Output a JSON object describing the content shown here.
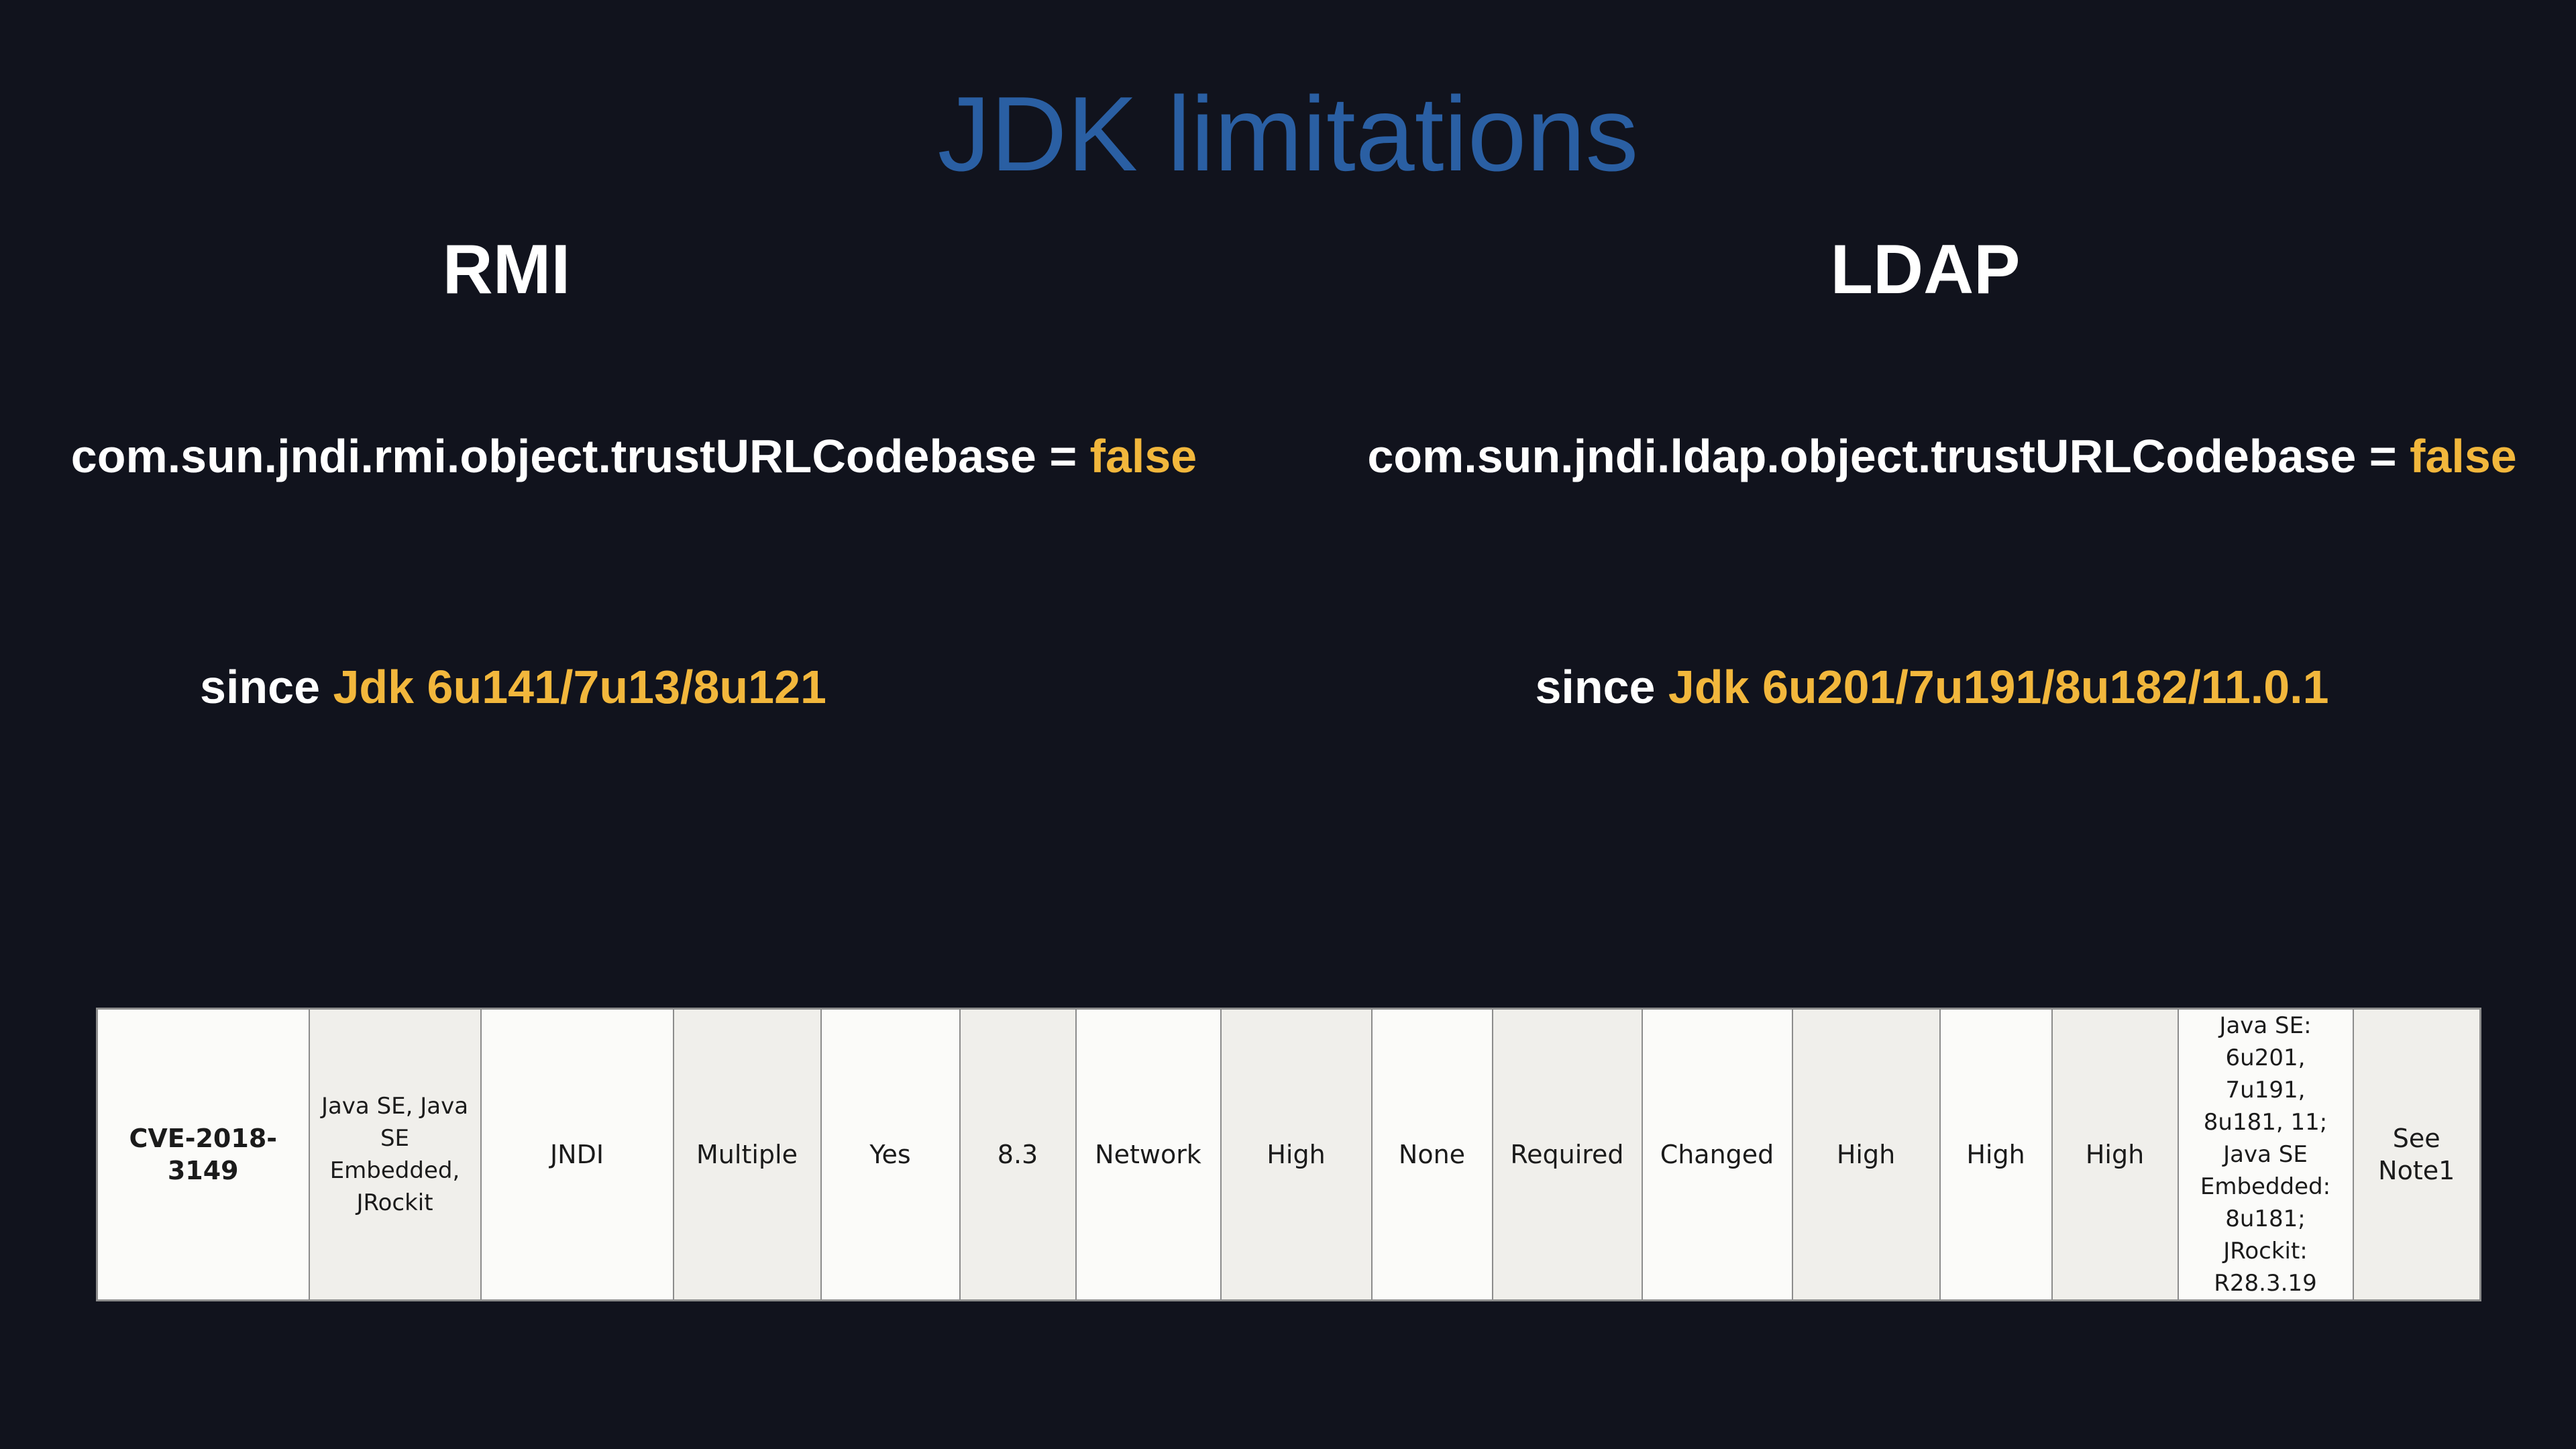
{
  "slide": {
    "title": "JDK limitations",
    "rmi": {
      "heading": "RMI",
      "property_prefix": "com.sun.jndi.rmi.object.trustURLCodebase = ",
      "property_value": "false",
      "since_prefix": "since ",
      "since_versions": "Jdk 6u141/7u13/8u121"
    },
    "ldap": {
      "heading": "LDAP",
      "property_prefix": "com.sun.jndi.ldap.object.trustURLCodebase = ",
      "property_value": "false",
      "since_prefix": "since ",
      "since_versions": "Jdk 6u201/7u191/8u182/11.0.1"
    },
    "accent_color": "#f2b73c",
    "title_color": "#2a5fa3",
    "background_color": "#11131d"
  },
  "cve_table": {
    "row": {
      "cve_id": "CVE-2018-3149",
      "products": [
        "Java SE, Java",
        "SE",
        "Embedded,",
        "JRockit"
      ],
      "component": "JNDI",
      "protocol": "Multiple",
      "remote_exploit": "Yes",
      "base_score": "8.3",
      "attack_vector": "Network",
      "attack_complexity": "High",
      "privileges_required": "None",
      "user_interaction": "Required",
      "scope": "Changed",
      "confidentiality": "High",
      "integrity": "High",
      "availability": "High",
      "affected_versions": [
        "Java SE:",
        "6u201, 7u191,",
        "8u181, 11;",
        "Java SE",
        "Embedded:",
        "8u181;",
        "JRockit:",
        "R28.3.19"
      ],
      "notes": [
        "See",
        "Note1"
      ]
    }
  }
}
